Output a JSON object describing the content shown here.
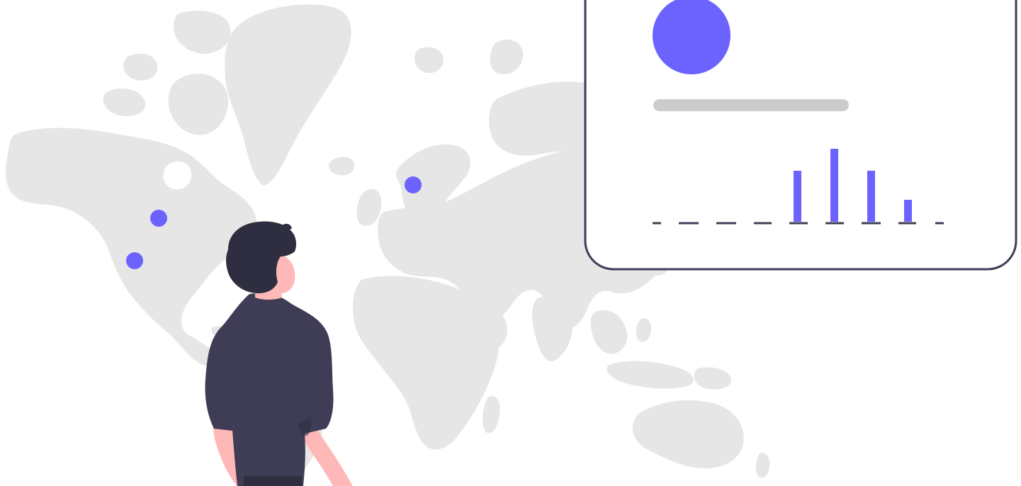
{
  "illustration": {
    "theme": "world-map-analytics",
    "colors": {
      "background": "#ffffff",
      "map_land": "#e6e6e6",
      "accent": "#6c63ff",
      "card_border": "#3f3d56",
      "card_fill": "#ffffff",
      "placeholder_bar": "#cccccc",
      "baseline": "#3f3d56",
      "person_shirt": "#3f3d56",
      "person_hair": "#2f2e41",
      "person_skin": "#ffb8b8"
    },
    "map_markers": [
      "north-america-north",
      "north-america-south",
      "northern-europe"
    ],
    "card": {
      "avatar_icon": "avatar-circle-icon",
      "chart_levels": [
        0.7,
        1.0,
        0.7,
        0.3
      ]
    }
  }
}
